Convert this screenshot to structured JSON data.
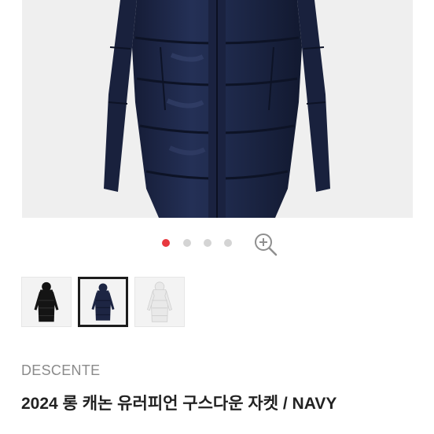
{
  "product": {
    "brand": "DESCENTE",
    "title": "2024 롱 캐논 유러피언 구스다운 자켓 / NAVY",
    "main_image": "navy-long-down-jacket-photo",
    "colors": {
      "accent": "#e8383f",
      "coat_navy": "#1d2543",
      "coat_black": "#141414",
      "coat_white": "#e9e9e9"
    }
  },
  "carousel": {
    "dot_count": 4,
    "active_index": 0,
    "zoom_icon": "zoom-in-icon"
  },
  "thumbnails": [
    {
      "name": "black-down-jacket-thumbnail",
      "selected": false
    },
    {
      "name": "navy-down-jacket-thumbnail",
      "selected": true
    },
    {
      "name": "white-down-jacket-thumbnail",
      "selected": false
    }
  ]
}
